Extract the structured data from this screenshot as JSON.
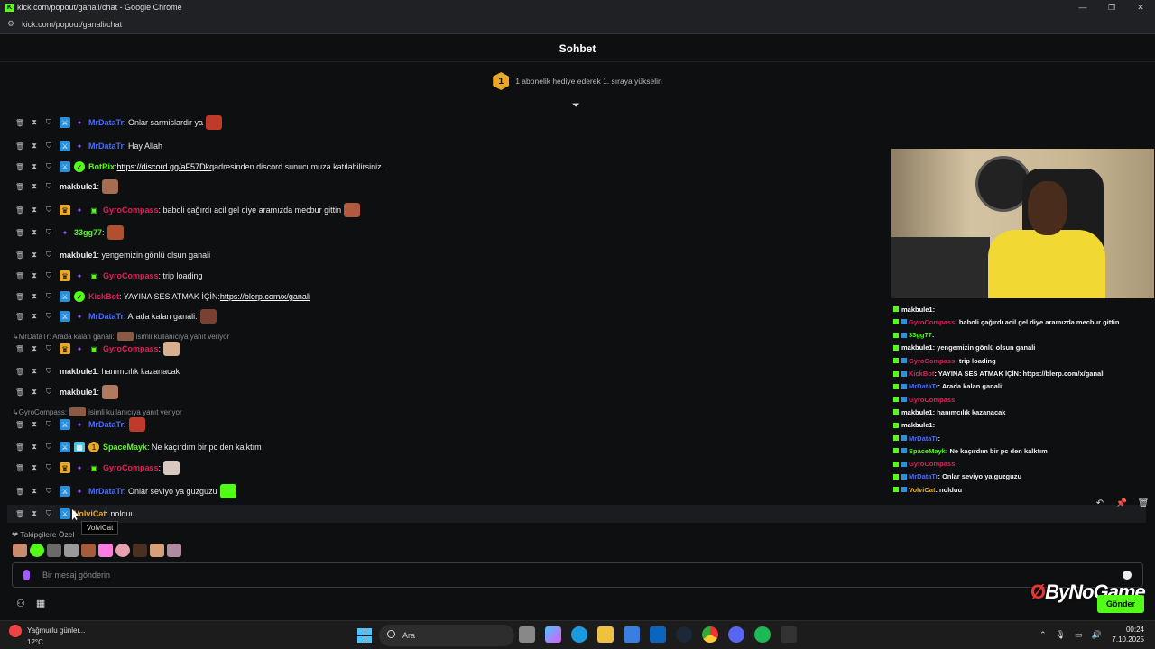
{
  "window": {
    "title": "kick.com/popout/ganali/chat - Google Chrome",
    "url": "kick.com/popout/ganali/chat",
    "controls": [
      "—",
      "❐",
      "✕"
    ]
  },
  "chat": {
    "header": "Sohbet",
    "gift_badge": "1",
    "gift_text": "1 abonelik hediye ederek 1. sıraya yükselin",
    "messages": [
      {
        "user": "MrDataTr",
        "color": "#4a6cf7",
        "text": ": Onlar sarmislardir ya"
      },
      {
        "user": "MrDataTr",
        "color": "#4a6cf7",
        "text": ": Hay Allah"
      },
      {
        "user": "BotRix",
        "color": "#53fc18",
        "text": ": ",
        "link": "https://discord.gg/aF57Dkq",
        "text2": " adresinden discord sunucumuza katılabilirsiniz."
      },
      {
        "user": "makbule1",
        "color": "#e8e8e8",
        "text": ":"
      },
      {
        "user": "GyroCompass",
        "color": "#e0205a",
        "text": ": baboli çağırdı acil gel diye aramızda mecbur gittin"
      },
      {
        "user": "33gg77",
        "color": "#53fc18",
        "text": ":"
      },
      {
        "user": "makbule1",
        "color": "#e8e8e8",
        "text": ": yengemizin gönlü olsun ganali"
      },
      {
        "user": "GyroCompass",
        "color": "#e0205a",
        "text": ": trip loading"
      },
      {
        "user": "KickBot",
        "color": "#e0205a",
        "text": ": YAYINA SES ATMAK İÇİN: ",
        "link": "https://blerp.com/x/ganali"
      },
      {
        "user": "MrDataTr",
        "color": "#4a6cf7",
        "text": ": Arada kalan ganali:"
      },
      {
        "user": "GyroCompass",
        "color": "#e0205a",
        "text": ":"
      },
      {
        "user": "makbule1",
        "color": "#e8e8e8",
        "text": ": hanımcılık kazanacak"
      },
      {
        "user": "makbule1",
        "color": "#e8e8e8",
        "text": ":"
      },
      {
        "user": "MrDataTr",
        "color": "#4a6cf7",
        "text": ":"
      },
      {
        "user": "SpaceMayk",
        "color": "#53fc18",
        "text": ": Ne kaçırdım bir pc den kalktım"
      },
      {
        "user": "GyroCompass",
        "color": "#e0205a",
        "text": ":"
      },
      {
        "user": "MrDataTr",
        "color": "#4a6cf7",
        "text": ": Onlar seviyo ya guzguzu"
      },
      {
        "user": "VolviCat",
        "color": "#e8a92a",
        "text": ": nolduu"
      }
    ],
    "replies": [
      {
        "prefix": "MrDataTr: Arada kalan ganali:",
        "suffix": "isimli kullanıcıya yanıt veriyor"
      },
      {
        "prefix": "GyroCompass:",
        "suffix": "isimli kullanıcıya yanıt veriyor"
      }
    ],
    "tooltip": "VolviCat",
    "followers_label": "Takipçilere Özel",
    "input_placeholder": "Bir mesaj gönderin",
    "send_label": "Gönder"
  },
  "brand": {
    "prefix": "By",
    "name": "NoGame"
  },
  "overlay_chat": [
    {
      "user": "makbule1",
      "color": "#ffffff",
      "text": " :"
    },
    {
      "user": "GyroCompass",
      "color": "#e0205a",
      "text": " : baboli çağırdı acil gel diye aramızda mecbur gittin"
    },
    {
      "user": "33gg77",
      "color": "#53fc18",
      "text": " :"
    },
    {
      "user": "makbule1",
      "color": "#ffffff",
      "text": " : yengemizin gönlü olsun ganali"
    },
    {
      "user": "GyroCompass",
      "color": "#e0205a",
      "text": " : trip loading"
    },
    {
      "user": "KickBot",
      "color": "#e0205a",
      "text": " : YAYINA SES ATMAK İÇİN: https://blerp.com/x/ganali"
    },
    {
      "user": "MrDataTr",
      "color": "#4a6cf7",
      "text": " : Arada kalan ganali:"
    },
    {
      "user": "GyroCompass",
      "color": "#e0205a",
      "text": " :"
    },
    {
      "user": "makbule1",
      "color": "#ffffff",
      "text": " : hanımcılık kazanacak"
    },
    {
      "user": "makbule1",
      "color": "#ffffff",
      "text": " :"
    },
    {
      "user": "MrDataTr",
      "color": "#4a6cf7",
      "text": " :"
    },
    {
      "user": "SpaceMayk",
      "color": "#53fc18",
      "text": " : Ne kaçırdım bir pc den kalktım"
    },
    {
      "user": "GyroCompass",
      "color": "#e0205a",
      "text": " :"
    },
    {
      "user": "MrDataTr",
      "color": "#4a6cf7",
      "text": " : Onlar seviyo ya guzguzu"
    },
    {
      "user": "VolviCat",
      "color": "#e8a92a",
      "text": " : nolduu"
    }
  ],
  "taskbar": {
    "weather_title": "Yağmurlu günler...",
    "weather_temp": "12°C",
    "weather_badge": "6",
    "search_label": "Ara",
    "time": "00:24",
    "date": "7.10.2025"
  },
  "colors": {
    "accent": "#53fc18",
    "background": "#0e0f11",
    "moderator": "#2b8fd9",
    "vip": "#a55bff"
  }
}
